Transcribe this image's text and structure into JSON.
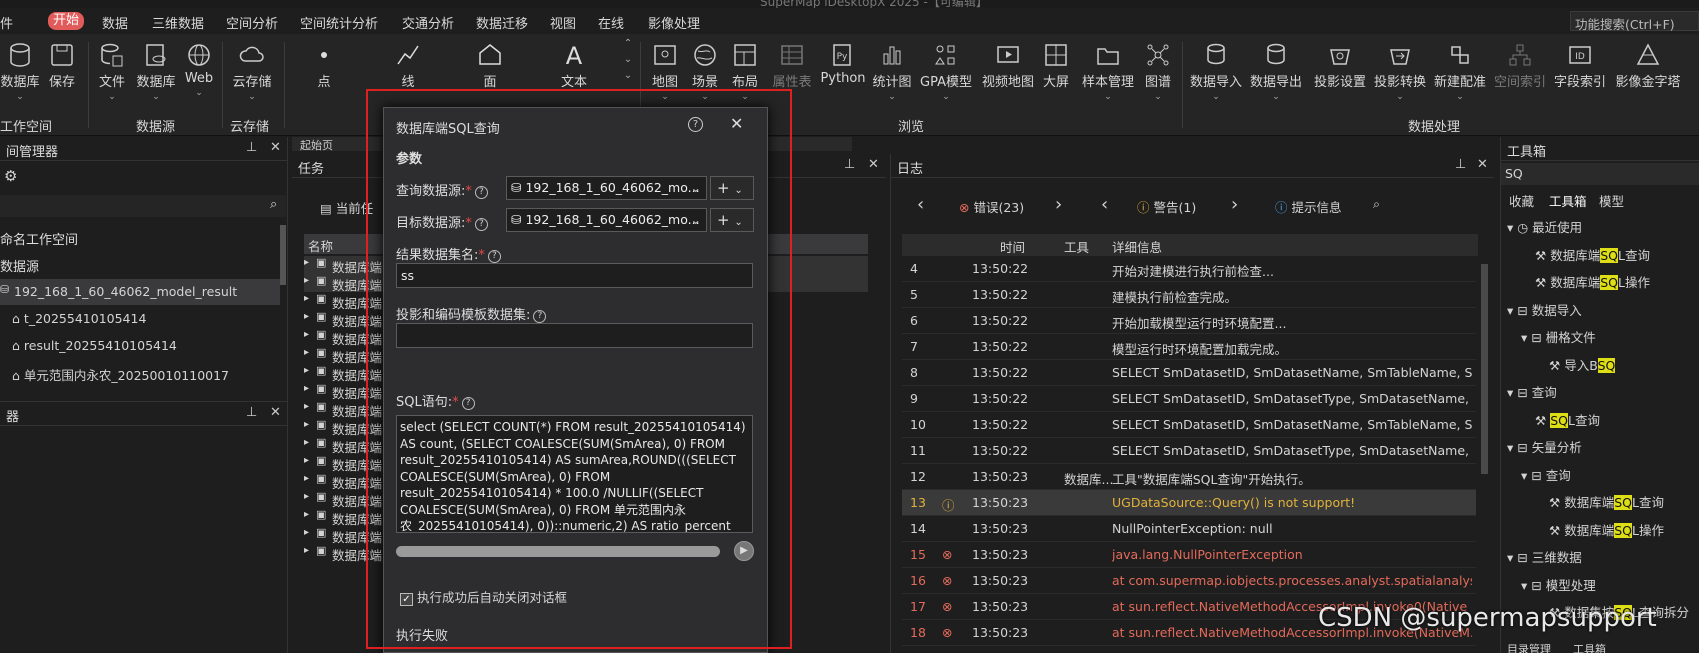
{
  "window": {
    "title": "SuperMap iDesktopX 2025 -【可编辑】"
  },
  "menu": {
    "items": [
      "件",
      "开始",
      "数据",
      "三维数据",
      "空间分析",
      "空间统计分析",
      "交通分析",
      "数据迁移",
      "视图",
      "在线",
      "影像处理"
    ],
    "active": "开始"
  },
  "function_search": "功能搜索(Ctrl+F)",
  "ribbon": {
    "buttons": [
      "数据库",
      "保存",
      "文件",
      "数据库",
      "Web",
      "云存储",
      "点",
      "线",
      "面",
      "文本",
      "地图",
      "场景",
      "布局",
      "属性表",
      "Python",
      "统计图",
      "GPA模型",
      "视频地图",
      "大屏",
      "样本管理",
      "图谱",
      "数据导入",
      "数据导出",
      "投影设置",
      "投影转换",
      "新建配准",
      "空间索引",
      "字段索引",
      "影像金字塔"
    ],
    "groups": [
      "工作空间",
      "数据源",
      "云存储",
      "浏览",
      "数据处理"
    ]
  },
  "workspace_panel": {
    "title": "间管理器",
    "items": [
      "命名工作空间",
      "数据源",
      "192_168_1_60_46062_model_result",
      "t_20255410105414",
      "result_20255410105414",
      "单元范围内永农_20250010110017"
    ]
  },
  "layer_panel": {
    "title": "器"
  },
  "start_tab": "起始页",
  "task_panel": {
    "title": "任务",
    "current": "当前任",
    "col_name": "名称",
    "row_label": "数据库端"
  },
  "dialog": {
    "title": "数据库端SQL查询",
    "section": "参数",
    "query_ds_label": "查询数据源:",
    "query_ds_value": "192_168_1_60_46062_mo...",
    "target_ds_label": "目标数据源:",
    "target_ds_value": "192_168_1_60_46062_mo...",
    "result_name_label": "结果数据集名:",
    "result_name_value": "ss",
    "proj_label": "投影和编码模板数据集:",
    "proj_value": "",
    "sql_label": "SQL语句:",
    "sql_text": "select (SELECT COUNT(*) FROM result_20255410105414)\nAS count, (SELECT COALESCE(SUM(SmArea), 0) FROM\nresult_20255410105414) AS sumArea,ROUND(((SELECT\nCOALESCE(SUM(SmArea), 0) FROM\nresult_20255410105414) * 100.0 /NULLIF((SELECT\nCOALESCE(SUM(SmArea), 0) FROM 单元范围内永\n农_20255410105414), 0))::numeric,2) AS ratio_percent",
    "auto_close_label": "执行成功后自动关闭对话框",
    "auto_close": true,
    "status": "执行失败"
  },
  "log_panel": {
    "title": "日志",
    "errors_label": "错误(23)",
    "warnings_label": "警告(1)",
    "info_label": "提示信息",
    "columns": [
      "时间",
      "工具",
      "详细信息"
    ],
    "rows": [
      {
        "n": "4",
        "type": "",
        "time": "13:50:22",
        "tool": "",
        "msg": "开始对建模进行执行前检查..."
      },
      {
        "n": "5",
        "type": "",
        "time": "13:50:22",
        "tool": "",
        "msg": "建模执行前检查完成。"
      },
      {
        "n": "6",
        "type": "",
        "time": "13:50:22",
        "tool": "",
        "msg": "开始加载模型运行时环境配置..."
      },
      {
        "n": "7",
        "type": "",
        "time": "13:50:22",
        "tool": "",
        "msg": "模型运行时环境配置加载完成。"
      },
      {
        "n": "8",
        "type": "",
        "time": "13:50:22",
        "tool": "",
        "msg": "SELECT SmDatasetID, SmDatasetName, SmTableName, S..."
      },
      {
        "n": "9",
        "type": "",
        "time": "13:50:22",
        "tool": "",
        "msg": "SELECT SmDatasetID, SmDatasetType, SmDatasetName, S..."
      },
      {
        "n": "10",
        "type": "",
        "time": "13:50:22",
        "tool": "",
        "msg": "SELECT SmDatasetID, SmDatasetName, SmTableName, S..."
      },
      {
        "n": "11",
        "type": "",
        "time": "13:50:22",
        "tool": "",
        "msg": "SELECT SmDatasetID, SmDatasetType, SmDatasetName, S..."
      },
      {
        "n": "12",
        "type": "",
        "time": "13:50:23",
        "tool": "数据库...",
        "msg": "工具\"数据库端SQL查询\"开始执行。"
      },
      {
        "n": "13",
        "type": "warn",
        "time": "13:50:23",
        "tool": "",
        "msg": "UGDataSource::Query() is not support!"
      },
      {
        "n": "14",
        "type": "",
        "time": "13:50:23",
        "tool": "",
        "msg": "NullPointerException: null"
      },
      {
        "n": "15",
        "type": "err",
        "time": "13:50:23",
        "tool": "",
        "msg": "java.lang.NullPointerException"
      },
      {
        "n": "16",
        "type": "err",
        "time": "13:50:23",
        "tool": "",
        "msg": "at com.supermap.iobjects.processes.analyst.spatialanalyst..."
      },
      {
        "n": "17",
        "type": "err",
        "time": "13:50:23",
        "tool": "",
        "msg": "at sun.reflect.NativeMethodAccessorImpl.invoke0(Native ..."
      },
      {
        "n": "18",
        "type": "err",
        "time": "13:50:23",
        "tool": "",
        "msg": "at sun.reflect.NativeMethodAccessorImpl.invoke(NativeM..."
      }
    ]
  },
  "toolbox": {
    "title": "工具箱",
    "search": "SQ",
    "tabs": [
      "收藏",
      "工具箱",
      "模型"
    ],
    "bottom_tabs": [
      "目录管理",
      "工具箱"
    ],
    "tree": [
      {
        "label": "最近使用",
        "level": 0,
        "kind": "clock",
        "hl_before": "",
        "hl": "",
        "hl_after": ""
      },
      {
        "label": "",
        "level": 2,
        "kind": "tool",
        "hl_before": "数据库端",
        "hl": "SQ",
        "hl_after": "L查询"
      },
      {
        "label": "",
        "level": 2,
        "kind": "tool",
        "hl_before": "数据库端",
        "hl": "SQ",
        "hl_after": "L操作"
      },
      {
        "label": "数据导入",
        "level": 0,
        "kind": "box",
        "hl_before": "",
        "hl": "",
        "hl_after": ""
      },
      {
        "label": "栅格文件",
        "level": 1,
        "kind": "box",
        "hl_before": "",
        "hl": "",
        "hl_after": ""
      },
      {
        "label": "",
        "level": 3,
        "kind": "tool",
        "hl_before": "导入B",
        "hl": "SQ",
        "hl_after": ""
      },
      {
        "label": "查询",
        "level": 0,
        "kind": "box",
        "hl_before": "",
        "hl": "",
        "hl_after": ""
      },
      {
        "label": "",
        "level": 2,
        "kind": "tool",
        "hl_before": "",
        "hl": "SQ",
        "hl_after": "L查询"
      },
      {
        "label": "矢量分析",
        "level": 0,
        "kind": "box",
        "hl_before": "",
        "hl": "",
        "hl_after": ""
      },
      {
        "label": "查询",
        "level": 1,
        "kind": "box",
        "hl_before": "",
        "hl": "",
        "hl_after": ""
      },
      {
        "label": "",
        "level": 3,
        "kind": "tool",
        "hl_before": "数据库端",
        "hl": "SQ",
        "hl_after": "L查询"
      },
      {
        "label": "",
        "level": 3,
        "kind": "tool",
        "hl_before": "数据库端",
        "hl": "SQ",
        "hl_after": "L操作"
      },
      {
        "label": "三维数据",
        "level": 0,
        "kind": "box",
        "hl_before": "",
        "hl": "",
        "hl_after": ""
      },
      {
        "label": "模型处理",
        "level": 1,
        "kind": "box",
        "hl_before": "",
        "hl": "",
        "hl_after": ""
      },
      {
        "label": "",
        "level": 3,
        "kind": "tool",
        "hl_before": "数据集按",
        "hl": "SQ",
        "hl_after": "L查询拆分"
      }
    ]
  },
  "watermark": "CSDN @supermapsupport",
  "colors": {
    "accent": "#e25b5b",
    "error": "#e36a5a",
    "warning": "#e2b23a",
    "highlight": "#dede16",
    "red_frame": "#e02020"
  }
}
